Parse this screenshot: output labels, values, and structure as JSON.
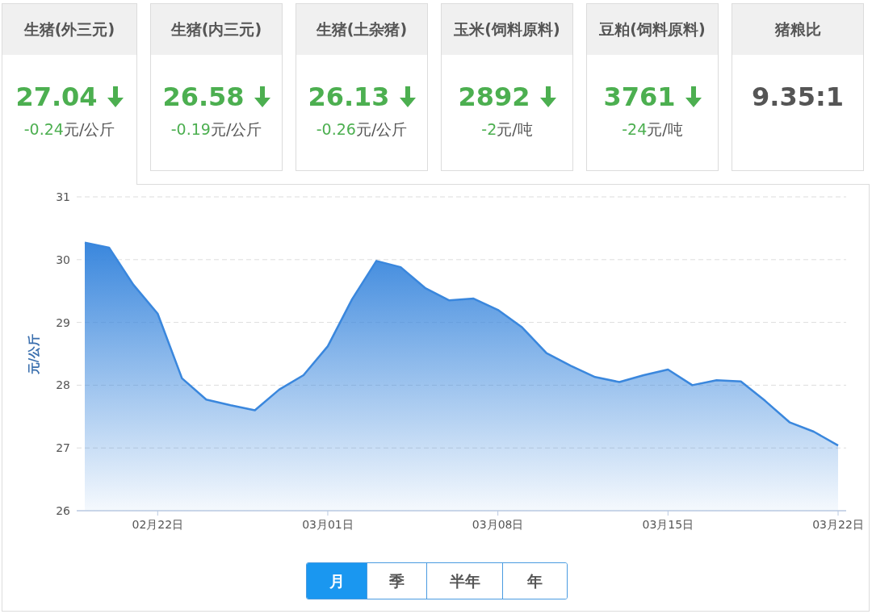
{
  "tabs": [
    {
      "title": "生猪(外三元)",
      "price": "27.04",
      "kind": "down",
      "change": "-0.24",
      "unit": "元/公斤",
      "selected": true
    },
    {
      "title": "生猪(内三元)",
      "price": "26.58",
      "kind": "down",
      "change": "-0.19",
      "unit": "元/公斤",
      "selected": false
    },
    {
      "title": "生猪(土杂猪)",
      "price": "26.13",
      "kind": "down",
      "change": "-0.26",
      "unit": "元/公斤",
      "selected": false
    },
    {
      "title": "玉米(饲料原料)",
      "price": "2892",
      "kind": "down",
      "change": "-2",
      "unit": "元/吨",
      "selected": false
    },
    {
      "title": "豆粕(饲料原料)",
      "price": "3761",
      "kind": "down",
      "change": "-24",
      "unit": "元/吨",
      "selected": false
    },
    {
      "title": "猪粮比",
      "price": "9.35:1",
      "kind": "ratio",
      "selected": false
    }
  ],
  "chart": {
    "chart_data": {
      "type": "area",
      "ylabel": "元/公斤",
      "categories": [
        null,
        null,
        null,
        "02月22日",
        null,
        null,
        null,
        null,
        null,
        null,
        "03月01日",
        null,
        null,
        null,
        null,
        null,
        null,
        "03月08日",
        null,
        null,
        null,
        null,
        null,
        null,
        "03月15日",
        null,
        null,
        null,
        null,
        null,
        null,
        "03月22日"
      ],
      "series": [
        {
          "color": "#3a87dd",
          "values": [
            30.27,
            30.19,
            29.6,
            29.14,
            28.11,
            27.77,
            27.68,
            27.6,
            27.93,
            28.16,
            28.62,
            29.37,
            29.98,
            29.88,
            29.55,
            29.35,
            29.38,
            29.2,
            28.92,
            28.51,
            28.31,
            28.13,
            28.05,
            28.16,
            28.25,
            28.0,
            28.08,
            28.06,
            27.75,
            27.41,
            27.26,
            27.04
          ]
        }
      ],
      "grid": true,
      "ylim": [
        26,
        31
      ],
      "yticks": [
        26,
        27,
        28,
        29,
        30,
        31
      ]
    }
  },
  "periods": [
    {
      "label": "月",
      "selected": true
    },
    {
      "label": "季",
      "selected": false
    },
    {
      "label": "半年",
      "selected": false
    },
    {
      "label": "年",
      "selected": false
    }
  ]
}
